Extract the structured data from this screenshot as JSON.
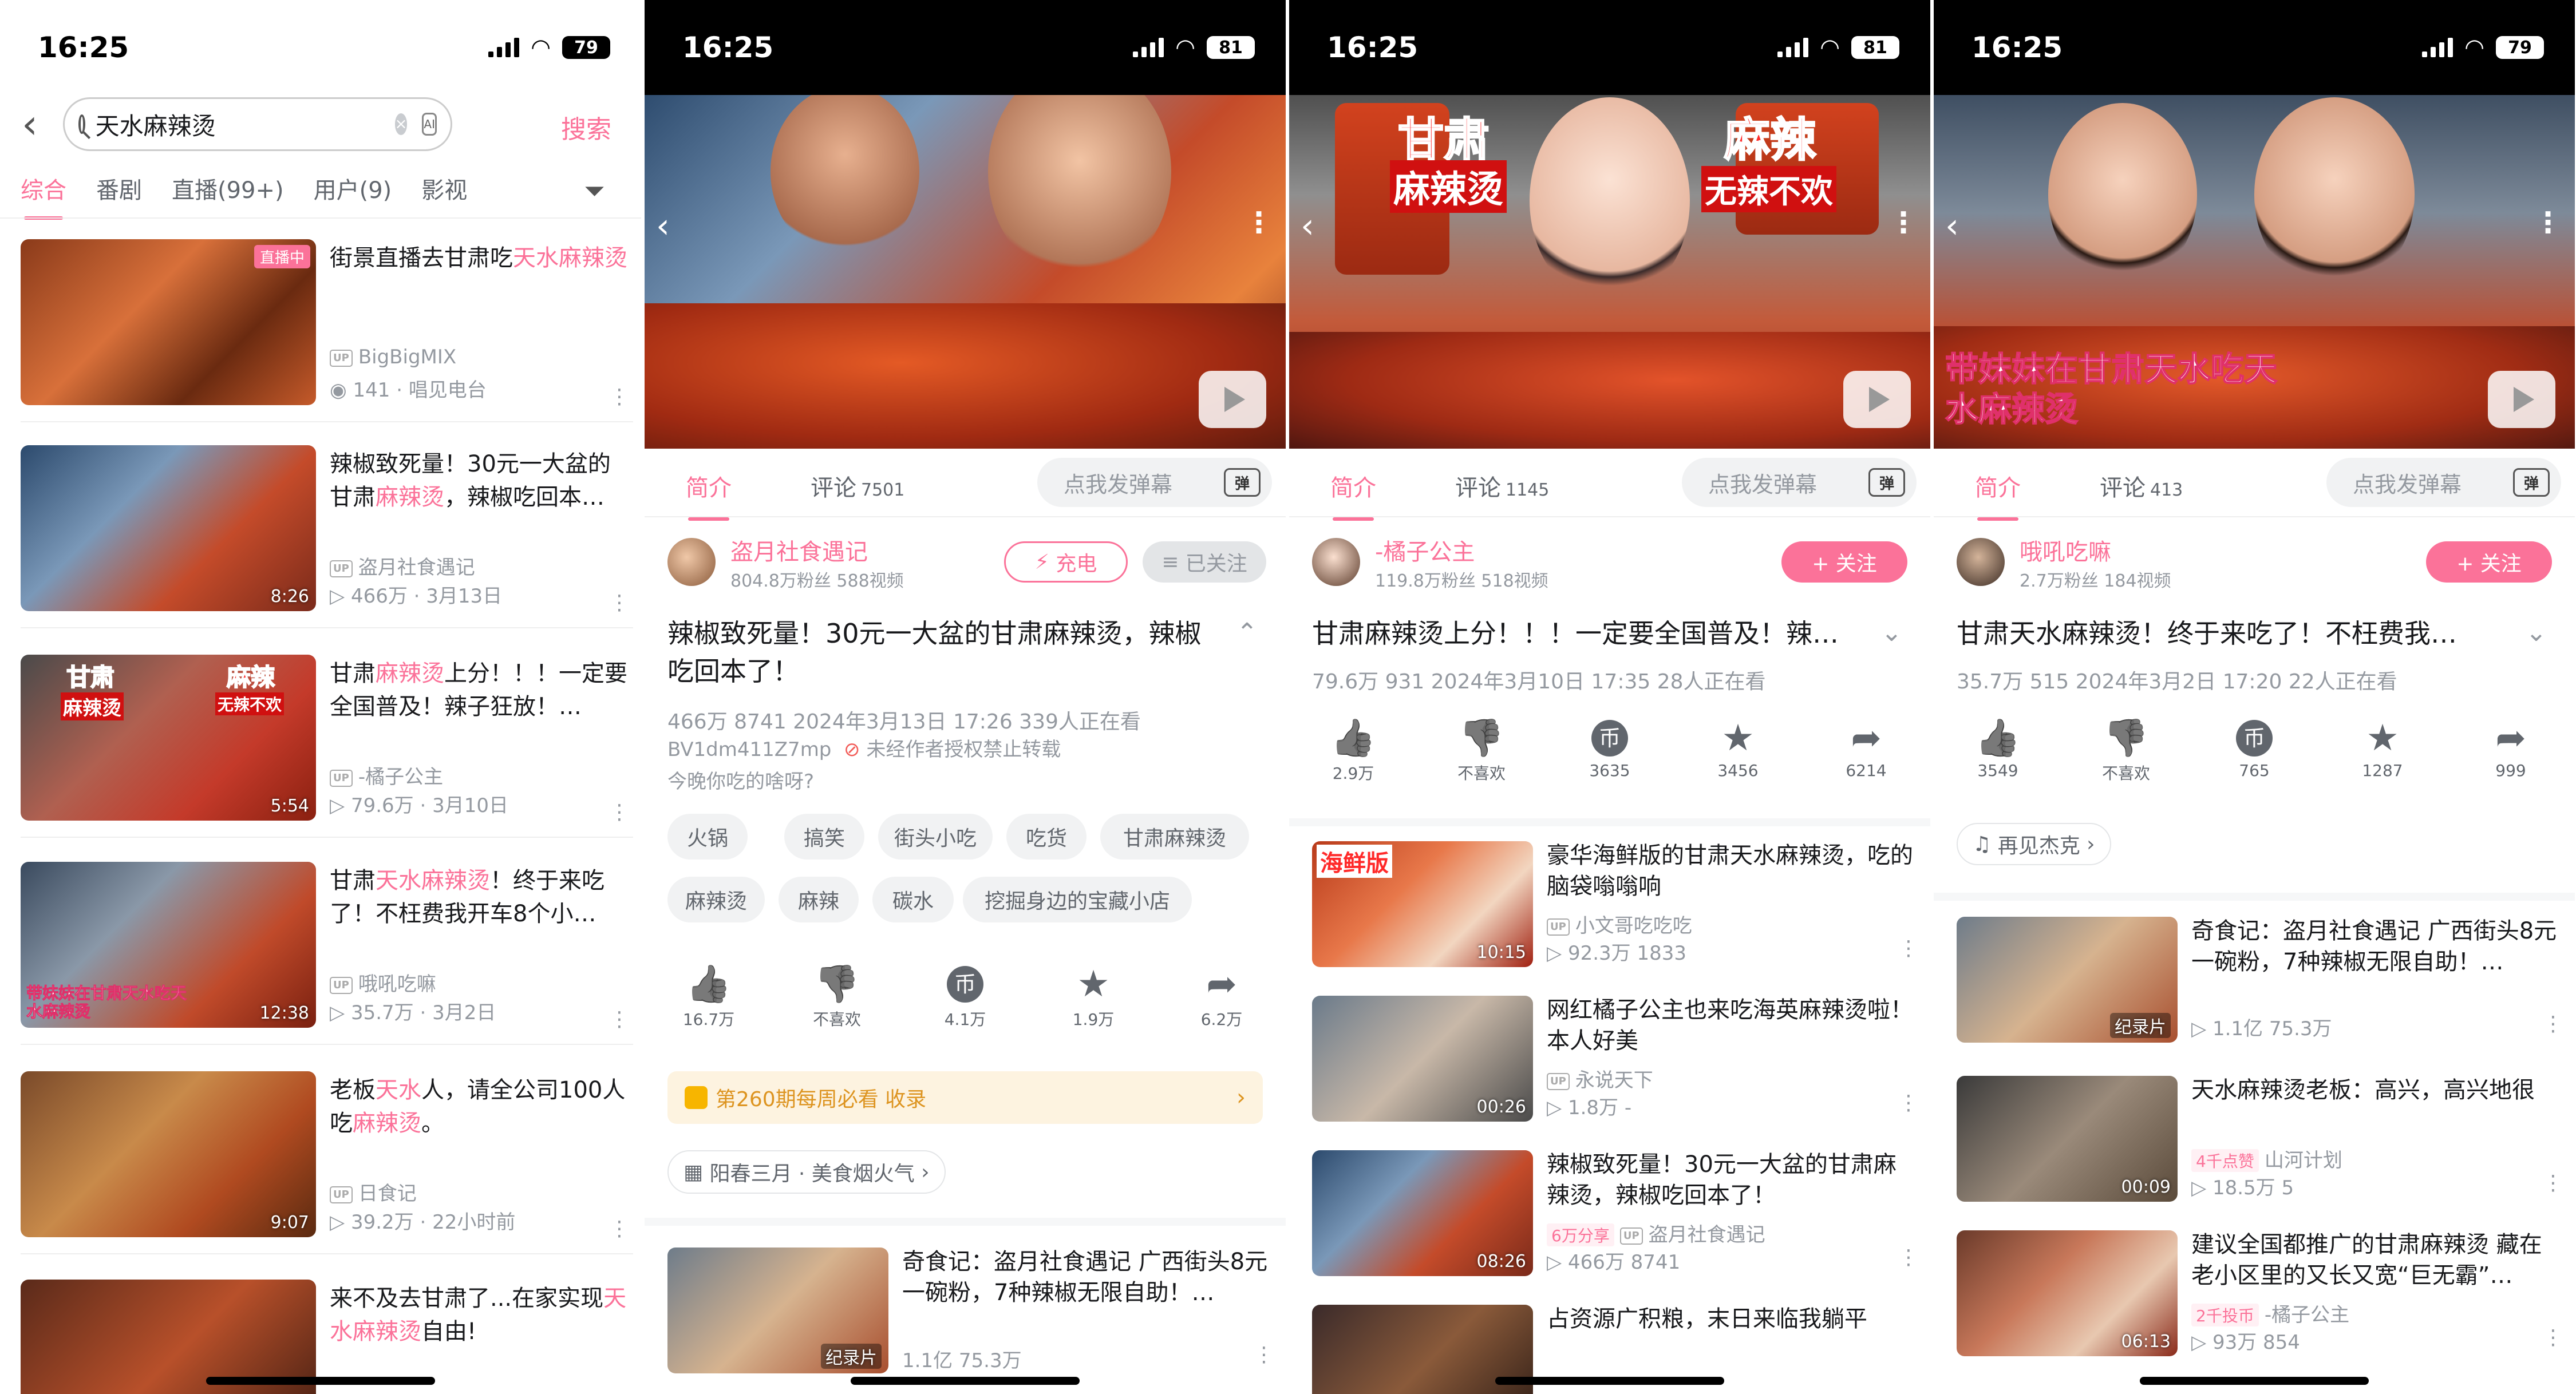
{
  "p1": {
    "status": {
      "time": "16:25",
      "battery": "79"
    },
    "search": {
      "value": "天水麻辣烫",
      "search_btn": "搜索",
      "ai": "AI"
    },
    "tabs": [
      "综合",
      "番剧",
      "直播(99+)",
      "用户(9)",
      "影视"
    ],
    "results": [
      {
        "t1": "街景直播去甘肃吃",
        "h1": "天水",
        "t2": "",
        "h2": "麻辣烫",
        "t3": "",
        "up": "BigBigMIX",
        "meta": "141 · 唱见电台",
        "duration": "",
        "live": "直播中"
      },
      {
        "t1": "辣椒致死量！30元一大盆的甘肃",
        "h1": "麻辣烫",
        "t2": "，辣椒吃回本…",
        "h2": "",
        "t3": "",
        "up": "盗月社食遇记",
        "meta": "466万 · 3月13日",
        "duration": "8:26",
        "live": ""
      },
      {
        "t1": "甘肃",
        "h1": "麻辣烫",
        "t2": "上分！！！一定要全国普及！辣子狂放！…",
        "h2": "",
        "t3": "",
        "up": "-橘子公主",
        "meta": "79.6万 · 3月10日",
        "duration": "5:54",
        "live": ""
      },
      {
        "t1": "甘肃",
        "h1": "天水麻辣烫",
        "t2": "！终于来吃了！不枉费我开车8个小…",
        "h2": "",
        "t3": "",
        "up": "哦吼吃嘛",
        "meta": "35.7万 · 3月2日",
        "duration": "12:38",
        "live": ""
      },
      {
        "t1": "老板",
        "h1": "天水",
        "t2": "人，请全公司100人吃",
        "h2": "麻辣烫",
        "t3": "。",
        "up": "日食记",
        "meta": "39.2万 · 22小时前",
        "duration": "9:07",
        "live": ""
      },
      {
        "t1": "来不及去甘肃了...在家实现",
        "h1": "天水麻辣烫",
        "t2": "自由!",
        "h2": "",
        "t3": "",
        "up": "",
        "meta": "",
        "duration": "",
        "live": ""
      }
    ],
    "thumb_text": {
      "t2a": "甘肃",
      "t2b": "麻辣烫",
      "t2c": "麻辣",
      "t2d": "无辣不欢",
      "t3": "带妹妹在甘肃天水吃天水麻辣烫"
    }
  },
  "p2": {
    "status": {
      "time": "16:25",
      "battery": "81"
    },
    "tabs": {
      "intro": "简介",
      "comments": "评论",
      "count": "7501",
      "danmaku": "点我发弹幕",
      "dm": "弹"
    },
    "uploader": {
      "name": "盗月社食遇记",
      "stats": "804.8万粉丝  588视频",
      "charge": "充电",
      "followed": "已关注"
    },
    "title": "辣椒致死量！30元一大盆的甘肃麻辣烫，辣椒吃回本了！",
    "meta": "466万  8741  2024年3月13日 17:26  339人正在看",
    "bv": "BV1dm411Z7mp",
    "noreprint": "未经作者授权禁止转载",
    "desc": "今晚你吃的啥呀?",
    "tags": [
      "火锅",
      "搞笑",
      "街头小吃",
      "吃货",
      "甘肃麻辣烫",
      "麻辣烫",
      "麻辣",
      "碳水",
      "挖掘身边的宝藏小店"
    ],
    "actions": [
      {
        "icon": "like-icon",
        "label": "16.7万"
      },
      {
        "icon": "dislike-icon",
        "label": "不喜欢"
      },
      {
        "icon": "coin-icon",
        "label": "4.1万"
      },
      {
        "icon": "star-icon",
        "label": "1.9万"
      },
      {
        "icon": "share-icon",
        "label": "6.2万"
      }
    ],
    "banner": "第260期每周必看 收录",
    "chip": "阳春三月 · 美食烟火气",
    "rec": [
      {
        "title": "奇食记：盗月社食遇记 广西街头8元一碗粉，7种辣椒无限自助！…",
        "meta": "1.1亿  75.3万",
        "badge": "纪录片"
      }
    ]
  },
  "p3": {
    "status": {
      "time": "16:25",
      "battery": "81"
    },
    "thumb_text": {
      "a": "甘肃",
      "b": "麻辣烫",
      "c": "麻辣",
      "d": "无辣不欢"
    },
    "tabs": {
      "intro": "简介",
      "comments": "评论",
      "count": "1145",
      "danmaku": "点我发弹幕",
      "dm": "弹"
    },
    "uploader": {
      "name": "-橘子公主",
      "stats": "119.8万粉丝  518视频",
      "follow": "+ 关注"
    },
    "title": "甘肃麻辣烫上分！！！一定要全国普及！辣…",
    "meta": "79.6万  931  2024年3月10日 17:35  28人正在看",
    "actions": [
      {
        "icon": "like-icon",
        "label": "2.9万"
      },
      {
        "icon": "dislike-icon",
        "label": "不喜欢"
      },
      {
        "icon": "coin-icon",
        "label": "3635"
      },
      {
        "icon": "star-icon",
        "label": "3456"
      },
      {
        "icon": "share-icon",
        "label": "6214"
      }
    ],
    "rec": [
      {
        "title": "豪华海鲜版的甘肃天水麻辣烫，吃的脑袋嗡嗡响",
        "up": "小文哥吃吃吃",
        "meta": "92.3万  1833",
        "duration": "10:15",
        "badge": ""
      },
      {
        "title": "网红橘子公主也来吃海英麻辣烫啦！本人好美",
        "up": "永说天下",
        "meta": "1.8万  -",
        "duration": "00:26",
        "badge": ""
      },
      {
        "title": "辣椒致死量！30元一大盆的甘肃麻辣烫，辣椒吃回本了！",
        "up": "盗月社食遇记",
        "meta": "466万  8741",
        "duration": "08:26",
        "badge": "6万分享"
      },
      {
        "title": "占资源广积粮，末日来临我躺平",
        "up": "",
        "meta": "",
        "duration": "",
        "badge": ""
      }
    ],
    "thumb_label": "海鲜版"
  },
  "p4": {
    "status": {
      "time": "16:25",
      "battery": "79"
    },
    "thumb_text": "带妹妹在甘肃天水吃天水麻辣烫",
    "tabs": {
      "intro": "简介",
      "comments": "评论",
      "count": "413",
      "danmaku": "点我发弹幕",
      "dm": "弹"
    },
    "uploader": {
      "name": "哦吼吃嘛",
      "stats": "2.7万粉丝  184视频",
      "follow": "+ 关注"
    },
    "title": "甘肃天水麻辣烫！终于来吃了！不枉费我…",
    "meta": "35.7万  515  2024年3月2日 17:20  22人正在看",
    "actions": [
      {
        "icon": "like-icon",
        "label": "3549"
      },
      {
        "icon": "dislike-icon",
        "label": "不喜欢"
      },
      {
        "icon": "coin-icon",
        "label": "765"
      },
      {
        "icon": "star-icon",
        "label": "1287"
      },
      {
        "icon": "share-icon",
        "label": "999"
      }
    ],
    "music": "再见杰克",
    "rec": [
      {
        "title": "奇食记：盗月社食遇记 广西街头8元一碗粉，7种辣椒无限自助！…",
        "up": "",
        "meta": "1.1亿  75.3万",
        "duration": "",
        "badge": "纪录片",
        "tag": ""
      },
      {
        "title": "天水麻辣烫老板：高兴，高兴地很",
        "up": "山河计划",
        "meta": "18.5万  5",
        "duration": "00:09",
        "badge": "",
        "tag": "4千点赞"
      },
      {
        "title": "建议全国都推广的甘肃麻辣烫 藏在老小区里的又长又宽“巨无霸”…",
        "up": "-橘子公主",
        "meta": "93万  854",
        "duration": "06:13",
        "badge": "",
        "tag": "2千投币"
      }
    ]
  }
}
